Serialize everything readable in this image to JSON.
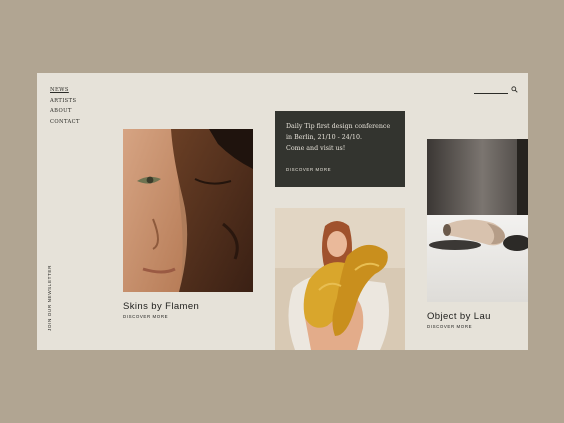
{
  "nav": {
    "items": [
      "NEWS",
      "ARTISTS",
      "ABOUT",
      "CONTACT"
    ]
  },
  "search": {
    "placeholder": "",
    "icon": "search-icon"
  },
  "newsletter": {
    "label": "JOIN OUR NEWSLETTER"
  },
  "cards": [
    {
      "title": "Skins by Flamen",
      "link": "DISCOVER MORE"
    },
    {
      "title": "Object by Lau",
      "link": "DISCOVER MORE"
    }
  ],
  "promo": {
    "text": "Daily Tip first design conference\nin Berlin, 21/10 - 24/10.\nCome and visit us!",
    "link": "DISCOVER MORE"
  },
  "colors": {
    "background": "#b1a592",
    "page": "#e6e2d9",
    "promo_bg": "#33342f",
    "accent_yellow": "#d9a62c"
  }
}
